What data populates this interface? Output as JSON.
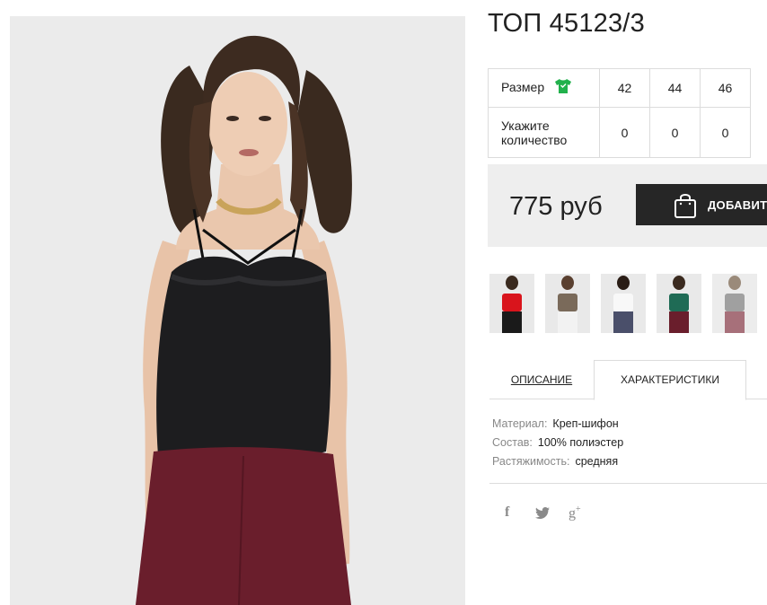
{
  "product": {
    "title": "ТОП 45123/3",
    "size_label": "Размер",
    "qty_label_1": "Укажите",
    "qty_label_2": "количество",
    "sizes": [
      "42",
      "44",
      "46"
    ],
    "quantities": [
      "0",
      "0",
      "0"
    ]
  },
  "purchase": {
    "price": "775 руб",
    "add_button": "ДОБАВИТЬ"
  },
  "thumbnails": [
    {
      "color": "#d9141c",
      "bottom": "#1a1a1a"
    },
    {
      "color": "#7a6a5a",
      "bottom": "#f2f2f2"
    },
    {
      "color": "#f4f4f4",
      "bottom": "#4a4f6a"
    },
    {
      "color": "#1f6b55",
      "bottom": "#6a1e2c"
    },
    {
      "color": "#8a8a8a",
      "bottom": "#5a1a24"
    }
  ],
  "tabs": {
    "description": "ОПИСАНИЕ",
    "characteristics": "ХАРАКТЕРИСТИКИ"
  },
  "specs": [
    {
      "key": "Материал:",
      "value": "Креп-шифон"
    },
    {
      "key": "Состав:",
      "value": "100% полиэстер"
    },
    {
      "key": "Растяжимость:",
      "value": "средняя"
    }
  ],
  "social": {
    "facebook": "f",
    "twitter": "twitter-icon",
    "googleplus": "g+"
  },
  "colors": {
    "accent_green": "#22b14c",
    "button_dark": "#262626",
    "price_bg": "#eeeeee"
  }
}
